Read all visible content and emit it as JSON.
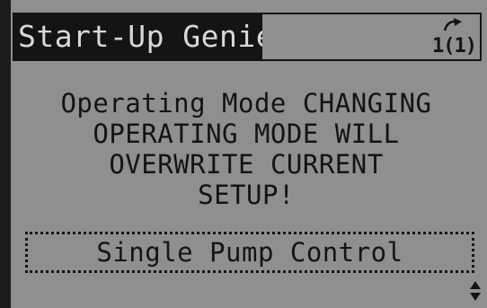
{
  "header": {
    "title": "Start-Up Genie",
    "setup_number": "1(1)"
  },
  "message": {
    "lines": [
      "Operating Mode CHANGING",
      "OPERATING MODE WILL",
      "OVERWRITE CURRENT",
      "SETUP!"
    ]
  },
  "selection": {
    "value": "Single Pump Control"
  },
  "colors": {
    "lcd_background": "#8f8f8f",
    "text": "#141414",
    "inverted_text": "#d8d8d8"
  },
  "icons": {
    "setup_indicator": "setup-arrow-icon",
    "scroll": "up-down-arrows-icon"
  }
}
